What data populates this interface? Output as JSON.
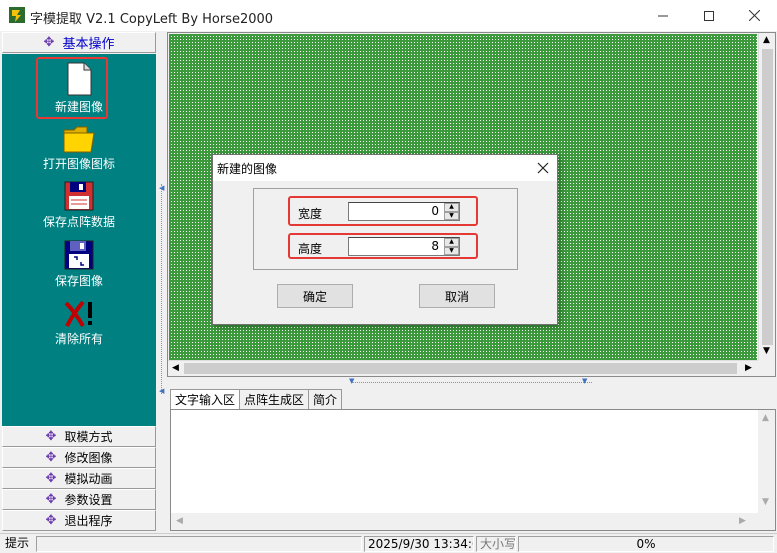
{
  "window": {
    "title": "字模提取 V2.1   CopyLeft By Horse2000",
    "icons": {
      "app": "app-icon",
      "minimize": "minimize-icon",
      "maximize": "maximize-icon",
      "close": "close-icon"
    }
  },
  "left_panel": {
    "header": {
      "icon": "✥",
      "label": "基本操作"
    },
    "tools": [
      {
        "label": "新建图像",
        "icon": "new-file-icon"
      },
      {
        "label": "打开图像图标",
        "icon": "folder-icon"
      },
      {
        "label": "保存点阵数据",
        "icon": "floppy-icon"
      },
      {
        "label": "保存图像",
        "icon": "save-image-icon"
      },
      {
        "label": "清除所有",
        "icon": "clear-icon"
      }
    ],
    "sections": [
      {
        "icon": "✥",
        "label": "取模方式"
      },
      {
        "icon": "✥",
        "label": "修改图像"
      },
      {
        "icon": "✥",
        "label": "模拟动画"
      },
      {
        "icon": "✥",
        "label": "参数设置"
      },
      {
        "icon": "✥",
        "label": "退出程序"
      }
    ]
  },
  "canvas": {
    "grid_color": "#3c9a3c",
    "highlight_color": "#e53935",
    "panel_color": "#008080"
  },
  "tabs": [
    {
      "label": "文字输入区",
      "active": true
    },
    {
      "label": "点阵生成区",
      "active": false
    },
    {
      "label": "简介",
      "active": false
    }
  ],
  "statusbar": {
    "hint": "提示",
    "datetime": "2025/9/30 13:34:00",
    "caps": "大小写",
    "progress": "0%"
  },
  "dialog": {
    "title": "新建的图像",
    "width_label": "宽度",
    "width_value": "0",
    "height_label": "高度",
    "height_value": "8",
    "ok_label": "确定",
    "cancel_label": "取消"
  }
}
